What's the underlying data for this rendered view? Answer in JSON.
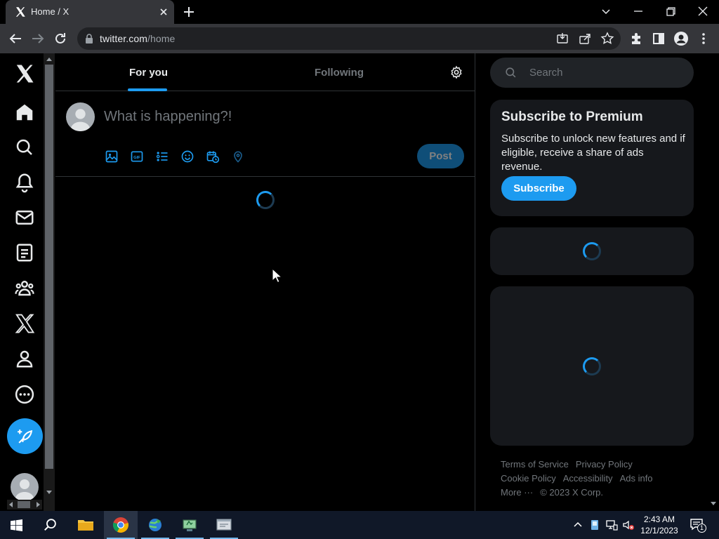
{
  "browser": {
    "tab_title": "Home / X",
    "url_domain": "twitter.com",
    "url_path": "/home"
  },
  "nav": {
    "items": [
      "x-logo",
      "home-icon",
      "explore-icon",
      "notifications-icon",
      "messages-icon",
      "lists-icon",
      "communities-icon",
      "premium-icon",
      "profile-icon",
      "more-icon"
    ]
  },
  "timeline": {
    "tabs": [
      {
        "label": "For you",
        "selected": true
      },
      {
        "label": "Following",
        "selected": false
      }
    ],
    "compose_placeholder": "What is happening?!",
    "compose_tools": [
      "media-icon",
      "gif-icon",
      "poll-icon",
      "emoji-icon",
      "schedule-icon",
      "location-icon"
    ],
    "post_button": "Post"
  },
  "right": {
    "search_placeholder": "Search",
    "premium_title": "Subscribe to Premium",
    "premium_body": "Subscribe to unlock new features and if eligible, receive a share of ads revenue.",
    "subscribe_button": "Subscribe",
    "footer": {
      "terms": "Terms of Service",
      "privacy": "Privacy Policy",
      "cookie": "Cookie Policy",
      "accessibility": "Accessibility",
      "ads": "Ads info",
      "more": "More ···",
      "copyright": "© 2023 X Corp."
    }
  },
  "taskbar": {
    "time": "2:43 AM",
    "date": "12/1/2023",
    "notification_count": "1"
  },
  "colors": {
    "accent": "#1d9bf0",
    "background": "#000000",
    "card": "#16181c",
    "muted_text": "#71767b"
  }
}
